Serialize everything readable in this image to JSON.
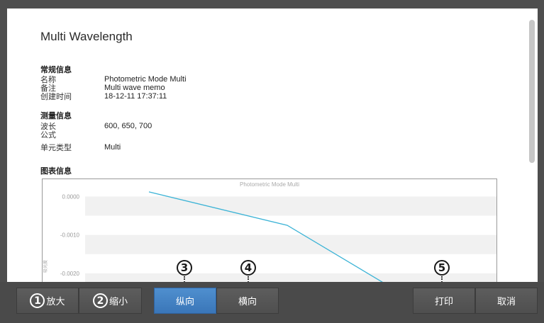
{
  "report": {
    "title": "Multi Wavelength",
    "general": {
      "heading": "常规信息",
      "fields": [
        {
          "label": "名称",
          "value": "Photometric Mode Multi"
        },
        {
          "label": "备注",
          "value": "Multi wave memo"
        },
        {
          "label": "创建时间",
          "value": "18-12-11 17:37:11"
        }
      ]
    },
    "measurement": {
      "heading": "测量信息",
      "fields": [
        {
          "label": "波长",
          "value": "600, 650, 700"
        },
        {
          "label": "公式",
          "value": ""
        },
        {
          "label": "单元类型",
          "value": "Multi"
        }
      ]
    },
    "chart_section": {
      "heading": "图表信息"
    }
  },
  "chart_data": {
    "type": "line",
    "title": "Photometric Mode Multi",
    "ylabel": "吸光度",
    "y_ticks": [
      "0.0000",
      "-0.0010",
      "-0.0020"
    ],
    "ylim": [
      -0.0025,
      0.00045
    ],
    "series": [
      {
        "color": "#3bb3d6",
        "points": [
          [
            1,
            0.00012
          ],
          [
            2,
            -0.00075
          ],
          [
            3,
            -0.0029
          ]
        ]
      }
    ]
  },
  "toolbar": {
    "zoom_in": {
      "num": "1",
      "label": "放大"
    },
    "zoom_out": {
      "num": "2",
      "label": "缩小"
    },
    "portrait": {
      "label": "纵向"
    },
    "landscape": {
      "label": "横向"
    },
    "print": {
      "label": "打印"
    },
    "cancel": {
      "label": "取消"
    }
  },
  "callouts": [
    "3",
    "4",
    "5"
  ],
  "colors": {
    "accent": "#3a7fc4",
    "toolbar": "#4a4a4a",
    "series": "#3bb3d6"
  }
}
